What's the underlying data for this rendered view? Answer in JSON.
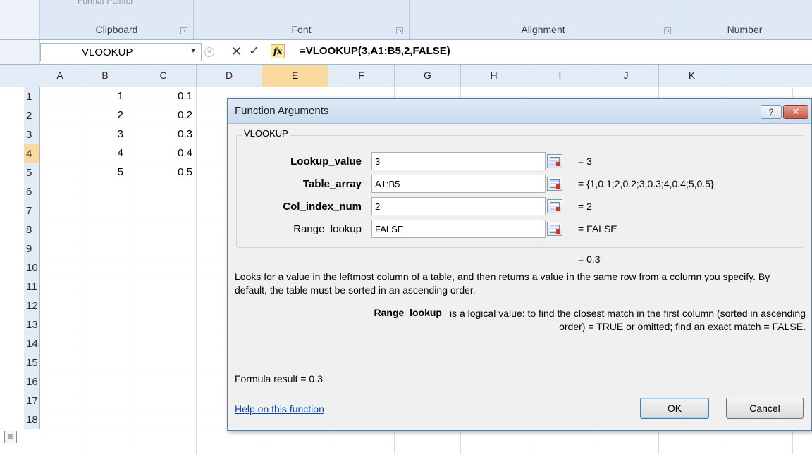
{
  "ribbon": {
    "groups": {
      "clipboard": "Clipboard",
      "font": "Font",
      "alignment": "Alignment",
      "number": "Number"
    },
    "format_painter": "Format Painter"
  },
  "formula_bar": {
    "name_box": "VLOOKUP",
    "fx": "fx",
    "formula": "=VLOOKUP(3,A1:B5,2,FALSE)"
  },
  "grid": {
    "columns": [
      "A",
      "B",
      "C",
      "D",
      "E",
      "F",
      "G",
      "H",
      "I",
      "J",
      "K"
    ],
    "selected_column": "E",
    "rows": [
      "1",
      "2",
      "3",
      "4",
      "5",
      "6",
      "7",
      "8",
      "9",
      "10",
      "11",
      "12",
      "13",
      "14",
      "15",
      "16",
      "17",
      "18"
    ],
    "selected_row": "4",
    "colA": [
      "1",
      "2",
      "3",
      "4",
      "5"
    ],
    "colB": [
      "0.1",
      "0.2",
      "0.3",
      "0.4",
      "0.5"
    ]
  },
  "dialog": {
    "title": "Function Arguments",
    "help_btn": "?",
    "close_btn": "✕",
    "group_label": "VLOOKUP",
    "args": [
      {
        "label": "Lookup_value",
        "value": "3",
        "eval": "=  3"
      },
      {
        "label": "Table_array",
        "value": "A1:B5",
        "eval": "=  {1,0.1;2,0.2;3,0.3;4,0.4;5,0.5}"
      },
      {
        "label": "Col_index_num",
        "value": "2",
        "eval": "=  2"
      },
      {
        "label": "Range_lookup",
        "value": "FALSE",
        "eval": "=  FALSE"
      }
    ],
    "result_eval": "=  0.3",
    "description": "Looks for a value in the leftmost column of a table, and then returns a value in the same row from a column you specify. By default, the table must be sorted in an ascending order.",
    "arg_desc_name": "Range_lookup",
    "arg_desc_text": "is a logical value: to find the closest match in the first column (sorted in ascending order) = TRUE or omitted; find an exact match = FALSE.",
    "formula_result": "Formula result =  0.3",
    "help_link": "Help on this function",
    "ok": "OK",
    "cancel": "Cancel"
  }
}
